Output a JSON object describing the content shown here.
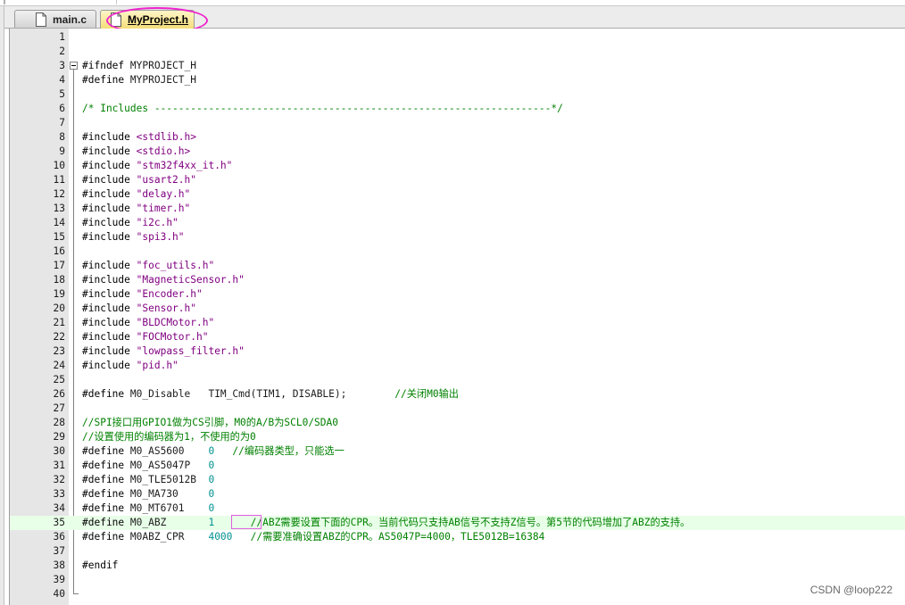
{
  "tabs": [
    {
      "label": "main.c",
      "active": false
    },
    {
      "label": "MyProject.h",
      "active": true
    }
  ],
  "lines": [
    {
      "n": "1",
      "p": []
    },
    {
      "n": "2",
      "p": []
    },
    {
      "n": "3",
      "p": [
        {
          "t": "#ifndef",
          "c": "dir"
        },
        {
          "t": " MYPROJECT_H",
          "c": "pp"
        }
      ]
    },
    {
      "n": "4",
      "p": [
        {
          "t": "#define",
          "c": "dir"
        },
        {
          "t": " MYPROJECT_H",
          "c": "pp"
        }
      ]
    },
    {
      "n": "5",
      "p": []
    },
    {
      "n": "6",
      "p": [
        {
          "t": "/* Includes ------------------------------------------------------------------*/",
          "c": "cmt"
        }
      ]
    },
    {
      "n": "7",
      "p": []
    },
    {
      "n": "8",
      "p": [
        {
          "t": "#include",
          "c": "dir"
        },
        {
          "t": " ",
          "c": "pp"
        },
        {
          "t": "<stdlib.h>",
          "c": "str"
        }
      ]
    },
    {
      "n": "9",
      "p": [
        {
          "t": "#include",
          "c": "dir"
        },
        {
          "t": " ",
          "c": "pp"
        },
        {
          "t": "<stdio.h>",
          "c": "str"
        }
      ]
    },
    {
      "n": "10",
      "p": [
        {
          "t": "#include",
          "c": "dir"
        },
        {
          "t": " ",
          "c": "pp"
        },
        {
          "t": "\"stm32f4xx_it.h\"",
          "c": "str"
        }
      ]
    },
    {
      "n": "11",
      "p": [
        {
          "t": "#include",
          "c": "dir"
        },
        {
          "t": " ",
          "c": "pp"
        },
        {
          "t": "\"usart2.h\"",
          "c": "str"
        }
      ]
    },
    {
      "n": "12",
      "p": [
        {
          "t": "#include",
          "c": "dir"
        },
        {
          "t": " ",
          "c": "pp"
        },
        {
          "t": "\"delay.h\"",
          "c": "str"
        }
      ]
    },
    {
      "n": "13",
      "p": [
        {
          "t": "#include",
          "c": "dir"
        },
        {
          "t": " ",
          "c": "pp"
        },
        {
          "t": "\"timer.h\"",
          "c": "str"
        }
      ]
    },
    {
      "n": "14",
      "p": [
        {
          "t": "#include",
          "c": "dir"
        },
        {
          "t": " ",
          "c": "pp"
        },
        {
          "t": "\"i2c.h\"",
          "c": "str"
        }
      ]
    },
    {
      "n": "15",
      "p": [
        {
          "t": "#include",
          "c": "dir"
        },
        {
          "t": " ",
          "c": "pp"
        },
        {
          "t": "\"spi3.h\"",
          "c": "str"
        }
      ]
    },
    {
      "n": "16",
      "p": []
    },
    {
      "n": "17",
      "p": [
        {
          "t": "#include",
          "c": "dir"
        },
        {
          "t": " ",
          "c": "pp"
        },
        {
          "t": "\"foc_utils.h\"",
          "c": "str"
        }
      ]
    },
    {
      "n": "18",
      "p": [
        {
          "t": "#include",
          "c": "dir"
        },
        {
          "t": " ",
          "c": "pp"
        },
        {
          "t": "\"MagneticSensor.h\"",
          "c": "str"
        }
      ]
    },
    {
      "n": "19",
      "p": [
        {
          "t": "#include",
          "c": "dir"
        },
        {
          "t": " ",
          "c": "pp"
        },
        {
          "t": "\"Encoder.h\"",
          "c": "str"
        }
      ]
    },
    {
      "n": "20",
      "p": [
        {
          "t": "#include",
          "c": "dir"
        },
        {
          "t": " ",
          "c": "pp"
        },
        {
          "t": "\"Sensor.h\"",
          "c": "str"
        }
      ]
    },
    {
      "n": "21",
      "p": [
        {
          "t": "#include",
          "c": "dir"
        },
        {
          "t": " ",
          "c": "pp"
        },
        {
          "t": "\"BLDCMotor.h\"",
          "c": "str"
        }
      ]
    },
    {
      "n": "22",
      "p": [
        {
          "t": "#include",
          "c": "dir"
        },
        {
          "t": " ",
          "c": "pp"
        },
        {
          "t": "\"FOCMotor.h\"",
          "c": "str"
        }
      ]
    },
    {
      "n": "23",
      "p": [
        {
          "t": "#include",
          "c": "dir"
        },
        {
          "t": " ",
          "c": "pp"
        },
        {
          "t": "\"lowpass_filter.h\"",
          "c": "str"
        }
      ]
    },
    {
      "n": "24",
      "p": [
        {
          "t": "#include",
          "c": "dir"
        },
        {
          "t": " ",
          "c": "pp"
        },
        {
          "t": "\"pid.h\"",
          "c": "str"
        }
      ]
    },
    {
      "n": "25",
      "p": []
    },
    {
      "n": "26",
      "p": [
        {
          "t": "#define",
          "c": "dir"
        },
        {
          "t": " M0_Disable   TIM_Cmd(TIM1, DISABLE);        ",
          "c": "pp"
        },
        {
          "t": "//关闭M0输出",
          "c": "cmt"
        }
      ]
    },
    {
      "n": "27",
      "p": []
    },
    {
      "n": "28",
      "p": [
        {
          "t": "//SPI接口用GPIO1做为CS引脚，M0的A/B为SCL0/SDA0",
          "c": "cmt"
        }
      ]
    },
    {
      "n": "29",
      "p": [
        {
          "t": "//设置使用的编码器为1，不使用的为0",
          "c": "cmt"
        }
      ]
    },
    {
      "n": "30",
      "p": [
        {
          "t": "#define",
          "c": "dir"
        },
        {
          "t": " M0_AS5600    ",
          "c": "pp"
        },
        {
          "t": "0",
          "c": "num"
        },
        {
          "t": "   ",
          "c": "pp"
        },
        {
          "t": "//编码器类型，只能选一",
          "c": "cmt"
        }
      ]
    },
    {
      "n": "31",
      "p": [
        {
          "t": "#define",
          "c": "dir"
        },
        {
          "t": " M0_AS5047P   ",
          "c": "pp"
        },
        {
          "t": "0",
          "c": "num"
        }
      ]
    },
    {
      "n": "32",
      "p": [
        {
          "t": "#define",
          "c": "dir"
        },
        {
          "t": " M0_TLE5012B  ",
          "c": "pp"
        },
        {
          "t": "0",
          "c": "num"
        }
      ]
    },
    {
      "n": "33",
      "p": [
        {
          "t": "#define",
          "c": "dir"
        },
        {
          "t": " M0_MA730     ",
          "c": "pp"
        },
        {
          "t": "0",
          "c": "num"
        }
      ]
    },
    {
      "n": "34",
      "p": [
        {
          "t": "#define",
          "c": "dir"
        },
        {
          "t": " M0_MT6701    ",
          "c": "pp"
        },
        {
          "t": "0",
          "c": "num"
        }
      ]
    },
    {
      "n": "35",
      "hl": true,
      "p": [
        {
          "t": "#define",
          "c": "dir"
        },
        {
          "t": " M0_ABZ       ",
          "c": "pp"
        },
        {
          "t": "1",
          "c": "num"
        },
        {
          "t": "      ",
          "c": "pp"
        },
        {
          "t": "//ABZ需要设置下面的CPR。当前代码只支持AB信号不支持Z信号。第5节的代码增加了ABZ的支持。",
          "c": "cmt"
        }
      ]
    },
    {
      "n": "36",
      "p": [
        {
          "t": "#define",
          "c": "dir"
        },
        {
          "t": " M0ABZ_CPR    ",
          "c": "pp"
        },
        {
          "t": "4000",
          "c": "num"
        },
        {
          "t": "   ",
          "c": "pp"
        },
        {
          "t": "//需要准确设置ABZ的CPR。AS5047P=4000，TLE5012B=16384",
          "c": "cmt"
        }
      ]
    },
    {
      "n": "37",
      "p": []
    },
    {
      "n": "38",
      "p": [
        {
          "t": "#endif",
          "c": "dir"
        }
      ]
    },
    {
      "n": "39",
      "p": []
    },
    {
      "n": "40",
      "p": []
    }
  ],
  "watermark": "CSDN @loop222",
  "colors": {
    "directive": "#000000",
    "string": "#800080",
    "number": "#009090",
    "comment": "#008000",
    "highlight_line": "#e8ffe8",
    "annotation": "#ee22cc"
  }
}
